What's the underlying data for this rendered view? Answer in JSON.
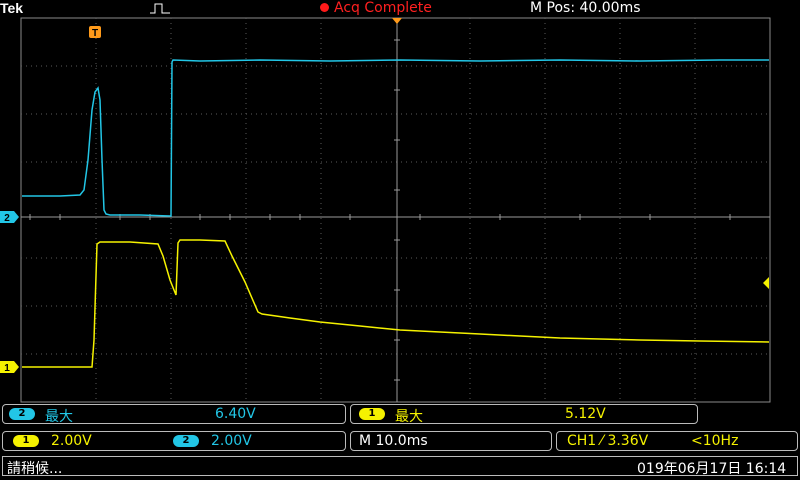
{
  "header": {
    "brand": "Tek",
    "acq_status": "Acq Complete",
    "mpos": "M Pos: 40.00ms",
    "trigger_marker": "T"
  },
  "markers": {
    "ch2": "2",
    "ch1": "1"
  },
  "measurements": {
    "m1": {
      "channel": "2",
      "label": "最大",
      "value": "6.40V"
    },
    "m2": {
      "channel": "1",
      "label": "最大",
      "value": "5.12V"
    }
  },
  "scales": {
    "ch1_channel": "1",
    "ch1": "2.00V",
    "ch2_channel": "2",
    "ch2": "2.00V",
    "timebase": "M 10.0ms",
    "trigger": "CH1 ⁄ 3.36V",
    "freq": "<10Hz"
  },
  "status": {
    "message": "請稍候...",
    "datetime": "019年06月17日 16:14"
  },
  "colors": {
    "ch1": "#f5f200",
    "ch2": "#22c6e6",
    "acq": "#ff2020",
    "trigger": "#ff9a1a"
  }
}
